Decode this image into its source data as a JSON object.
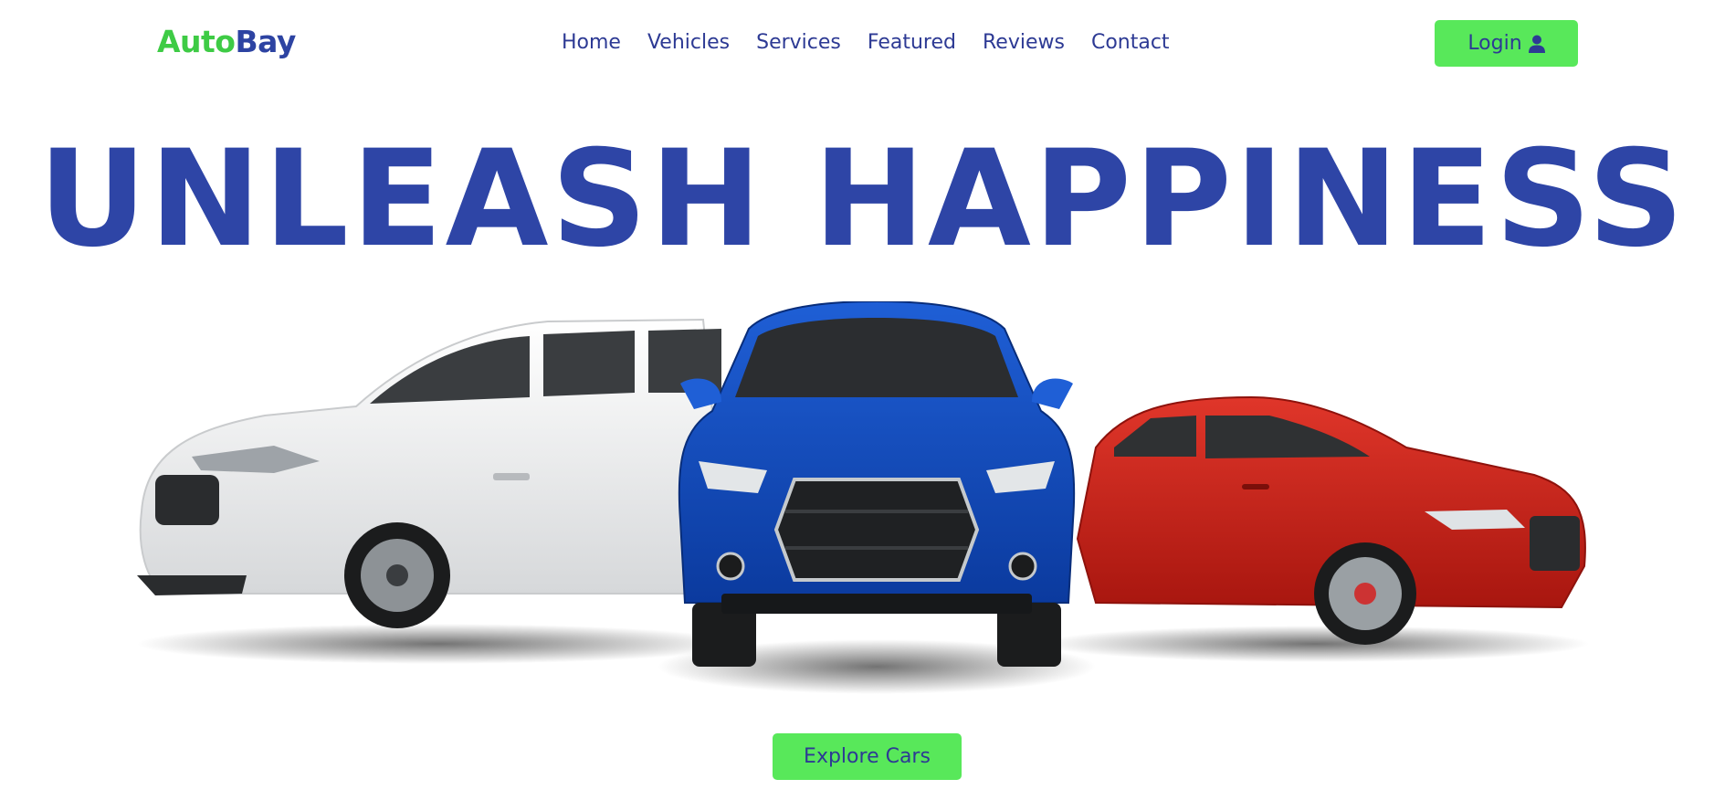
{
  "brand": {
    "part1": "Auto",
    "part2": "Bay"
  },
  "nav": {
    "items": [
      "Home",
      "Vehicles",
      "Services",
      "Featured",
      "Reviews",
      "Contact"
    ]
  },
  "header": {
    "login_label": "Login",
    "login_icon": "user-icon"
  },
  "hero": {
    "title": "UNLEASH HAPPINESS",
    "cta_label": "Explore Cars",
    "image": {
      "cars": [
        "white SUV",
        "blue SUV",
        "red sedan"
      ]
    }
  },
  "colors": {
    "brand_green": "#3ecb45",
    "brand_blue": "#2d43a2",
    "button_green": "#58e85a",
    "nav_text": "#2d3a94"
  }
}
